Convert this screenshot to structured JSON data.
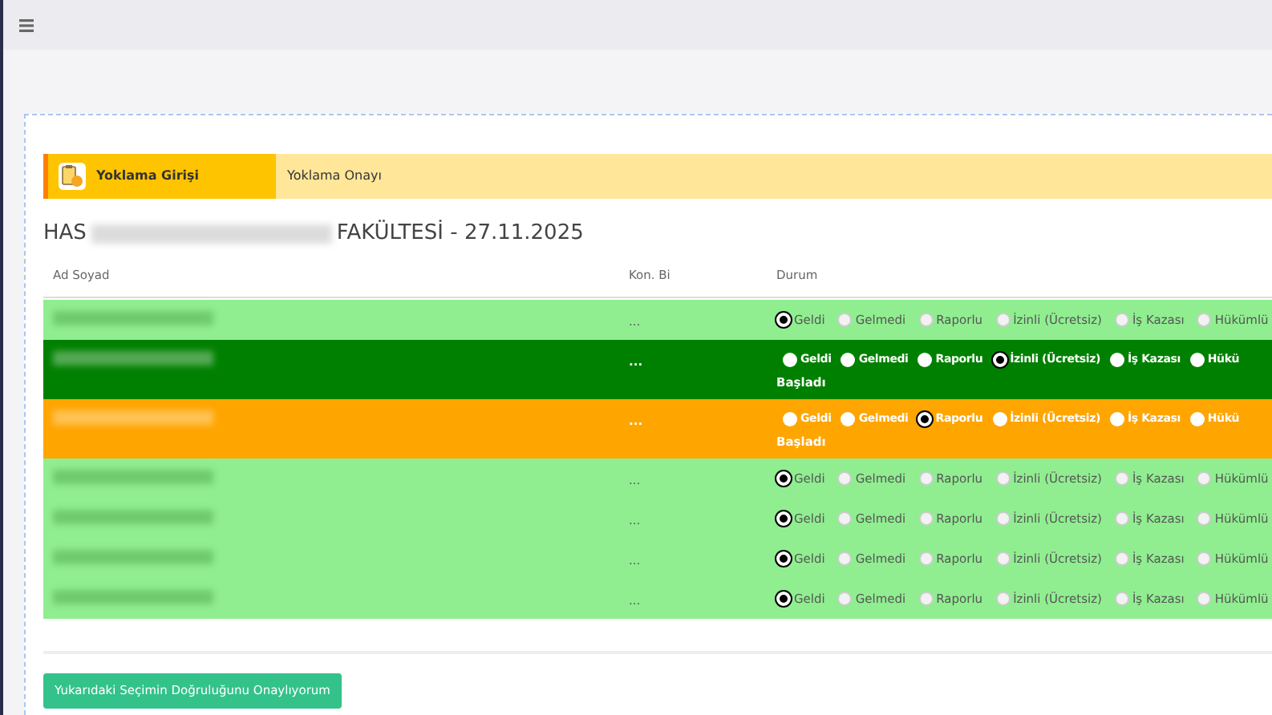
{
  "tabs": [
    {
      "label": "Yoklama Girişi",
      "selected": true
    },
    {
      "label": "Yoklama Onayı",
      "selected": false
    }
  ],
  "title": {
    "start": "HAS",
    "end": "FAKÜLTESİ - 27.11.2025"
  },
  "columns": [
    "Ad Soyad",
    "Kon. Bi",
    "Durum"
  ],
  "rows": [
    {
      "kind": "light",
      "kon": "...",
      "options": [
        {
          "label": "Geldi",
          "selected": true
        },
        {
          "label": "Gelmedi",
          "selected": false
        },
        {
          "label": "Raporlu",
          "selected": false
        },
        {
          "label": "İzinli (Ücretsiz)",
          "selected": false
        },
        {
          "label": "İş Kazası",
          "selected": false
        },
        {
          "label": "Hükümlü",
          "selected": false
        }
      ]
    },
    {
      "kind": "green",
      "kon": "...",
      "options": [
        {
          "label": "Geldi",
          "selected": false
        },
        {
          "label": "Gelmedi",
          "selected": false
        },
        {
          "label": "Raporlu",
          "selected": false
        },
        {
          "label": "İzinli (Ücretsiz)",
          "selected": true
        },
        {
          "label": "İş Kazası",
          "selected": false
        },
        {
          "label": "Hükü",
          "selected": false
        }
      ],
      "wrap_text": "Başladı"
    },
    {
      "kind": "orange",
      "kon": "...",
      "options": [
        {
          "label": "Geldi",
          "selected": false
        },
        {
          "label": "Gelmedi",
          "selected": false
        },
        {
          "label": "Raporlu",
          "selected": true
        },
        {
          "label": "İzinli (Ücretsiz)",
          "selected": false
        },
        {
          "label": "İş Kazası",
          "selected": false
        },
        {
          "label": "Hükü",
          "selected": false
        }
      ],
      "wrap_text": "Başladı"
    },
    {
      "kind": "light",
      "kon": "...",
      "options": [
        {
          "label": "Geldi",
          "selected": true
        },
        {
          "label": "Gelmedi",
          "selected": false
        },
        {
          "label": "Raporlu",
          "selected": false
        },
        {
          "label": "İzinli (Ücretsiz)",
          "selected": false
        },
        {
          "label": "İş Kazası",
          "selected": false
        },
        {
          "label": "Hükümlü",
          "selected": false
        }
      ]
    },
    {
      "kind": "light",
      "kon": "...",
      "options": [
        {
          "label": "Geldi",
          "selected": true
        },
        {
          "label": "Gelmedi",
          "selected": false
        },
        {
          "label": "Raporlu",
          "selected": false
        },
        {
          "label": "İzinli (Ücretsiz)",
          "selected": false
        },
        {
          "label": "İş Kazası",
          "selected": false
        },
        {
          "label": "Hükümlü",
          "selected": false
        }
      ]
    },
    {
      "kind": "light",
      "kon": "...",
      "options": [
        {
          "label": "Geldi",
          "selected": true
        },
        {
          "label": "Gelmedi",
          "selected": false
        },
        {
          "label": "Raporlu",
          "selected": false
        },
        {
          "label": "İzinli (Ücretsiz)",
          "selected": false
        },
        {
          "label": "İş Kazası",
          "selected": false
        },
        {
          "label": "Hükümlü",
          "selected": false
        }
      ]
    },
    {
      "kind": "light",
      "kon": "...",
      "options": [
        {
          "label": "Geldi",
          "selected": true
        },
        {
          "label": "Gelmedi",
          "selected": false
        },
        {
          "label": "Raporlu",
          "selected": false
        },
        {
          "label": "İzinli (Ücretsiz)",
          "selected": false
        },
        {
          "label": "İş Kazası",
          "selected": false
        },
        {
          "label": "Hükümlü",
          "selected": false
        }
      ]
    }
  ],
  "confirm_button": "Yukarıdaki Seçimin Doğruluğunu Onaylıyorum"
}
